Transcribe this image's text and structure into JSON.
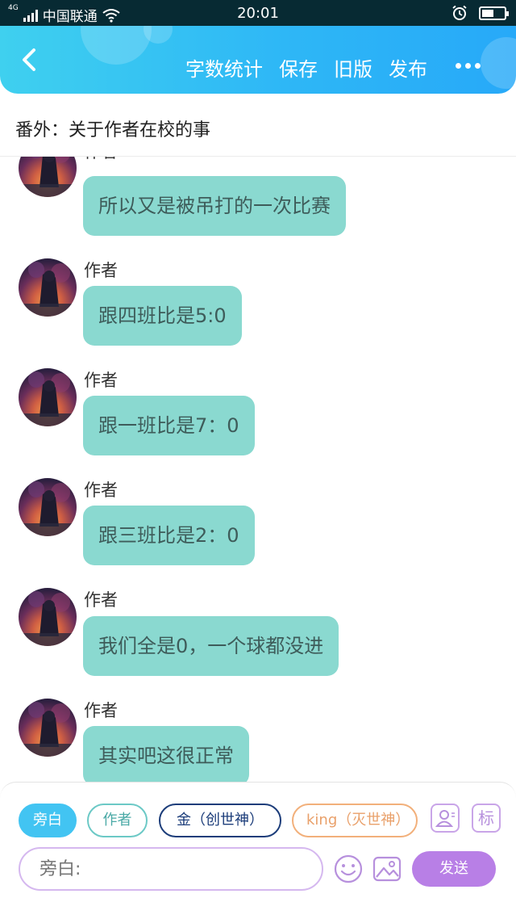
{
  "status_bar": {
    "network": "4G",
    "carrier": "中国联通",
    "time": "20:01",
    "battery_level": 0.55
  },
  "header": {
    "menu": [
      "字数统计",
      "保存",
      "旧版",
      "发布"
    ],
    "accent_gradient": [
      "#3fd0ef",
      "#27a9f8"
    ]
  },
  "chapter_title": "番外：关于作者在校的事",
  "messages": [
    {
      "sender": "作者",
      "text": "所以又是被吊打的一次比赛"
    },
    {
      "sender": "作者",
      "text": "跟四班比是5:0"
    },
    {
      "sender": "作者",
      "text": "跟一班比是7：0"
    },
    {
      "sender": "作者",
      "text": "跟三班比是2：0"
    },
    {
      "sender": "作者",
      "text": "我们全是0，一个球都没进"
    },
    {
      "sender": "作者",
      "text": "其实吧这很正常"
    }
  ],
  "roles": {
    "narrator": "旁白",
    "author": "作者",
    "jin": "金（创世神）",
    "king": "king（灭世神）"
  },
  "tools": {
    "tag_label": "标",
    "person_icon": "person-card-icon",
    "emoji_icon": "smiley-icon",
    "image_icon": "image-icon"
  },
  "input": {
    "placeholder": "旁白:",
    "send_label": "发送"
  },
  "colors": {
    "bubble": "#8ad9d0",
    "bubble_text": "#3e5c5a",
    "send": "#b87fe6"
  }
}
